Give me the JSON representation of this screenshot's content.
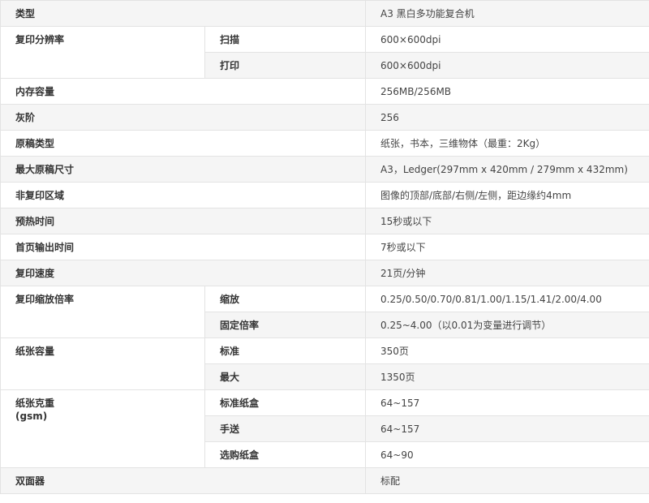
{
  "rows": [
    {
      "label": "类型",
      "value": "A3 黑白多功能复合机"
    },
    {
      "label": "复印分辨率",
      "subs": [
        {
          "sub": "扫描",
          "value": "600×600dpi"
        },
        {
          "sub": "打印",
          "value": "600×600dpi"
        }
      ]
    },
    {
      "label": "内存容量",
      "value": "256MB/256MB"
    },
    {
      "label": "灰阶",
      "value": "256"
    },
    {
      "label": "原稿类型",
      "value": "纸张，书本，三维物体（最重：2Kg）"
    },
    {
      "label": "最大原稿尺寸",
      "value": "A3，Ledger(297mm x 420mm / 279mm x 432mm)"
    },
    {
      "label": "非复印区域",
      "value": "图像的顶部/底部/右侧/左侧，距边缘约4mm"
    },
    {
      "label": "预热时间",
      "value": "15秒或以下"
    },
    {
      "label": "首页输出时间",
      "value": "7秒或以下"
    },
    {
      "label": "复印速度",
      "value": "21页/分钟"
    },
    {
      "label": "复印缩放倍率",
      "subs": [
        {
          "sub": "缩放",
          "value": "0.25/0.50/0.70/0.81/1.00/1.15/1.41/2.00/4.00"
        },
        {
          "sub": "固定倍率",
          "value": "0.25~4.00（以0.01为变量进行调节）"
        }
      ]
    },
    {
      "label": "纸张容量",
      "subs": [
        {
          "sub": "标准",
          "value": "350页"
        },
        {
          "sub": "最大",
          "value": "1350页"
        }
      ]
    },
    {
      "label": "纸张克重",
      "label2": "(gsm)",
      "subs": [
        {
          "sub": "标准纸盒",
          "value": "64~157"
        },
        {
          "sub": "手送",
          "value": "64~157"
        },
        {
          "sub": "选购纸盒",
          "value": "64~90"
        }
      ]
    },
    {
      "label": "双面器",
      "value": "标配"
    }
  ]
}
